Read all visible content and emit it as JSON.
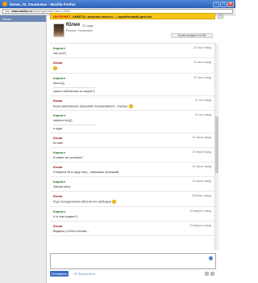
{
  "window": {
    "title": "Юлия, 22, Ульяновск - Mozilla Firefox"
  },
  "browser": {
    "url_host": "www.nardex.ru",
    "url_path": "/messenger/view?user=12345"
  },
  "left_panel": {
    "selected_contact": "Юлия"
  },
  "banner": {
    "text_start": "ИНТЕРНЕТ-",
    "text_strong": "АНКЕТА",
    "text_end": ": заполни анкеты — зарабатывай деньги!"
  },
  "profile": {
    "name": "Юлия",
    "age": "22 года",
    "location": "Россия, Ульяновск",
    "status": "Была сегодня в 11:56"
  },
  "messages": [
    {
      "author": "Кирилл",
      "role": "them",
      "time": "22 часа назад",
      "text": "как сон?)"
    },
    {
      "author": "Юлия",
      "role": "me",
      "time": "22 часа назад",
      "text": ""
    },
    {
      "author": "Кирилл",
      "role": "them",
      "time": "22 часа назад",
      "text": "Милок))",
      "text2": "какого любовника ты ищем?)"
    },
    {
      "author": "Юлия",
      "role": "me",
      "time": "21 час назад",
      "text": "Бери шампанское приезжай познакомимся , глупыш."
    },
    {
      "author": "Кирилл",
      "role": "them",
      "time": "21 час назад",
      "text": "нифига ты))))",
      "text2": "я куда"
    },
    {
      "author": "Юлия",
      "role": "me",
      "time": "13 часов назад",
      "text": "Ко мне"
    },
    {
      "author": "Кирилл",
      "role": "them",
      "time": "13 часов назад",
      "text": "И какие же условия?"
    },
    {
      "author": "Юлия",
      "role": "me",
      "time": "13 часов назад",
      "text": "Я вёрнся 28 в одну хату , освежишь приезжай"
    },
    {
      "author": "Кирилл",
      "role": "them",
      "time": "13 часов назад",
      "text": "Завтра могу"
    },
    {
      "author": "Юлия",
      "role": "me",
      "time": "28 минут назад",
      "text": "Я до понедельника абсолютно свободна"
    },
    {
      "author": "Кирилл",
      "role": "them",
      "time": "24 минуты назад",
      "text": "А в чем подвох?)"
    },
    {
      "author": "Юлия",
      "role": "me",
      "time": "23 минуты назад",
      "text": "Видимо у тебя в голове…"
    }
  ],
  "composer": {
    "send_label": "Отправить",
    "attach_label": "Прикрепить"
  }
}
